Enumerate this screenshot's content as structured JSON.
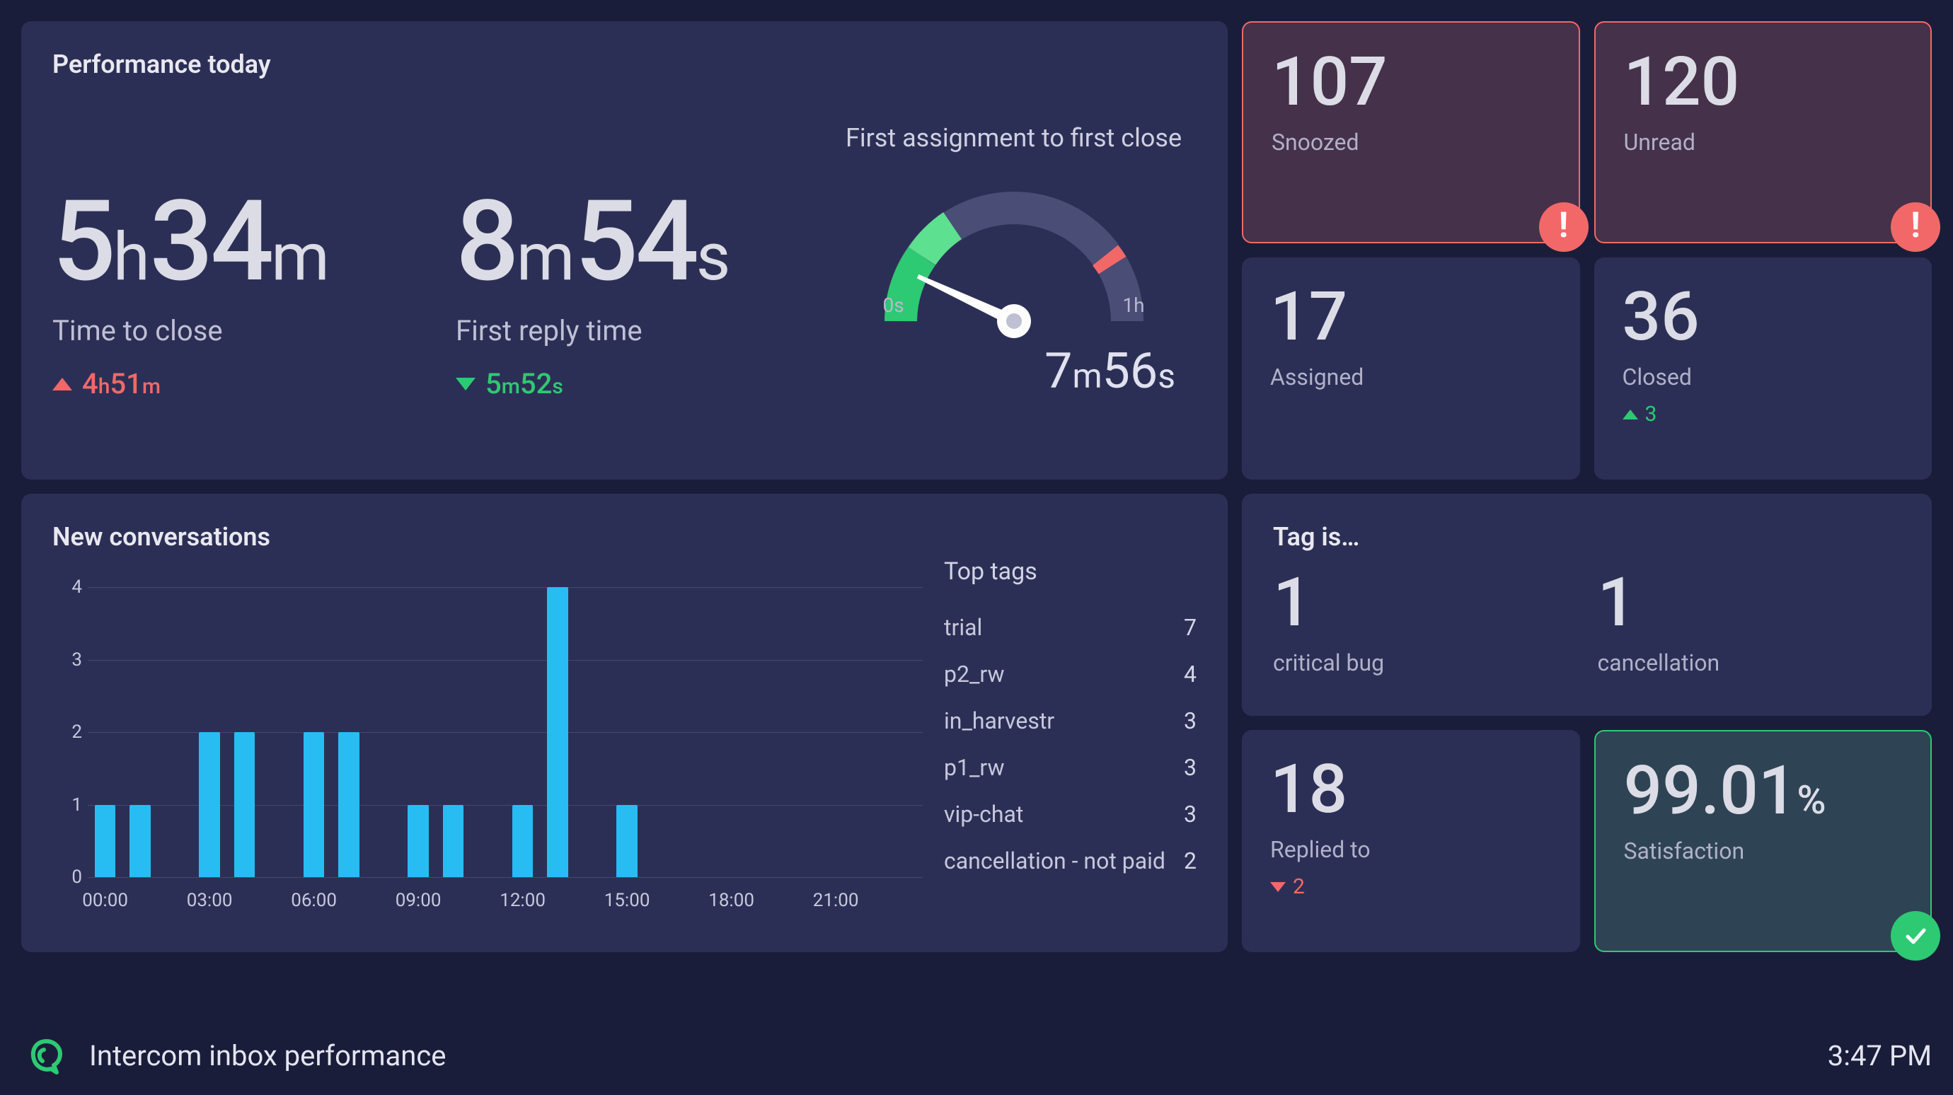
{
  "performance": {
    "title": "Performance today",
    "time_to_close": {
      "v1": "5",
      "u1": "h",
      "v2": "34",
      "u2": "m",
      "label": "Time to close",
      "delta_dir": "up",
      "delta_v1": "4",
      "delta_u1": "h",
      "delta_v2": "51",
      "delta_u2": "m"
    },
    "first_reply": {
      "v1": "8",
      "u1": "m",
      "v2": "54",
      "u2": "s",
      "label": "First reply time",
      "delta_dir": "down",
      "delta_v1": "5",
      "delta_u1": "m",
      "delta_v2": "52",
      "delta_u2": "s"
    },
    "gauge": {
      "title": "First assignment to first close",
      "min": "0s",
      "max": "1h",
      "v1": "7",
      "u1": "m",
      "v2": "56",
      "u2": "s"
    }
  },
  "kpis_top": {
    "snoozed": {
      "value": "107",
      "label": "Snoozed"
    },
    "unread": {
      "value": "120",
      "label": "Unread"
    },
    "assigned": {
      "value": "17",
      "label": "Assigned"
    },
    "closed": {
      "value": "36",
      "label": "Closed",
      "delta": "3",
      "delta_dir": "up-green"
    }
  },
  "new_conv": {
    "title": "New conversations",
    "tags_title": "Top tags",
    "tags": [
      {
        "name": "trial",
        "count": "7"
      },
      {
        "name": "p2_rw",
        "count": "4"
      },
      {
        "name": "in_harvestr",
        "count": "3"
      },
      {
        "name": "p1_rw",
        "count": "3"
      },
      {
        "name": "vip-chat",
        "count": "3"
      },
      {
        "name": "cancellation - not paid",
        "count": "2"
      }
    ]
  },
  "tag_is": {
    "title": "Tag is…",
    "a": {
      "value": "1",
      "label": "critical bug"
    },
    "b": {
      "value": "1",
      "label": "cancellation"
    }
  },
  "replied": {
    "value": "18",
    "label": "Replied to",
    "delta": "2",
    "delta_dir": "down-red"
  },
  "satisfaction": {
    "value": "99.01",
    "pct": "%",
    "label": "Satisfaction"
  },
  "footer": {
    "title": "Intercom inbox performance",
    "clock": "3:47 PM"
  },
  "chart_data": {
    "type": "bar",
    "title": "New conversations",
    "ylabel": "",
    "ylim": [
      0,
      4
    ],
    "yticks": [
      0,
      1,
      2,
      3,
      4
    ],
    "categories": [
      "00:00",
      "01:00",
      "02:00",
      "03:00",
      "04:00",
      "05:00",
      "06:00",
      "07:00",
      "08:00",
      "09:00",
      "10:00",
      "11:00",
      "12:00",
      "13:00",
      "14:00",
      "15:00",
      "16:00",
      "17:00",
      "18:00",
      "19:00",
      "20:00",
      "21:00",
      "22:00",
      "23:00"
    ],
    "xtick_labels": [
      "00:00",
      "03:00",
      "06:00",
      "09:00",
      "12:00",
      "15:00",
      "18:00",
      "21:00"
    ],
    "values": [
      1,
      1,
      0,
      2,
      2,
      0,
      2,
      2,
      0,
      1,
      1,
      0,
      1,
      4,
      0,
      1,
      0,
      0,
      0,
      0,
      0,
      0,
      0,
      0
    ]
  }
}
